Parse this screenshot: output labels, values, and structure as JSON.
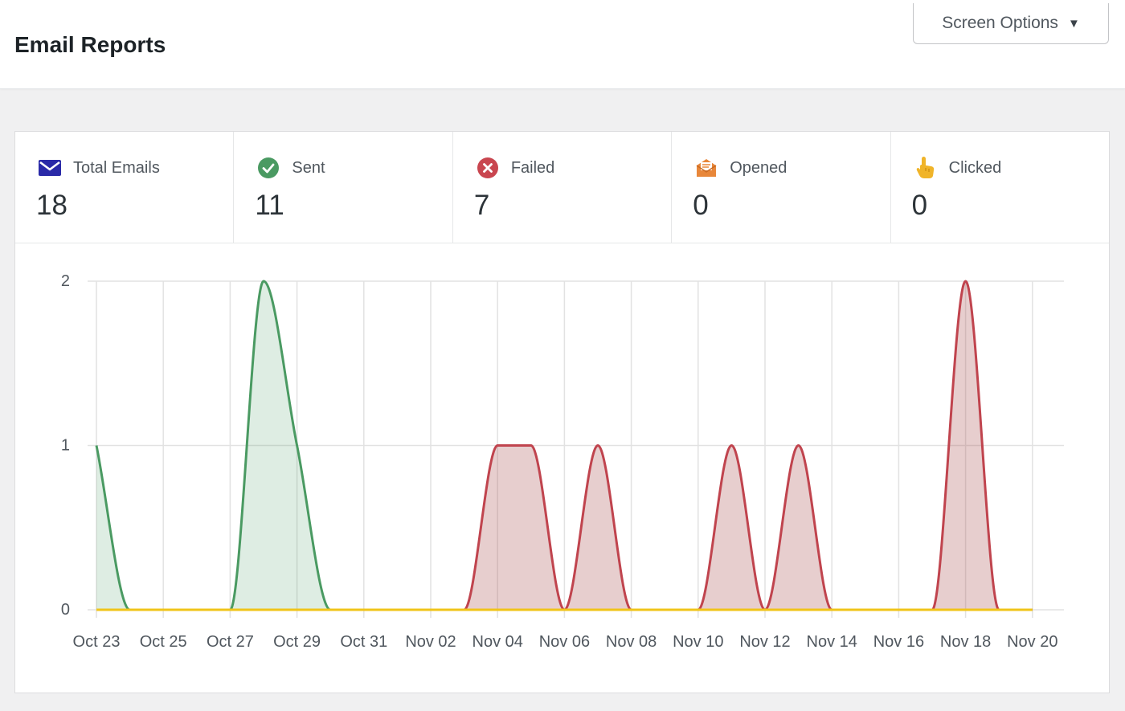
{
  "header": {
    "title": "Email Reports",
    "screen_options_label": "Screen Options"
  },
  "stats": [
    {
      "label": "Total Emails",
      "value": "18",
      "icon": "envelope-icon",
      "color": "#2a2aa8"
    },
    {
      "label": "Sent",
      "value": "11",
      "icon": "check-circle-icon",
      "color": "#4a9a62"
    },
    {
      "label": "Failed",
      "value": "7",
      "icon": "x-circle-icon",
      "color": "#c9464f"
    },
    {
      "label": "Opened",
      "value": "0",
      "icon": "open-envelope-icon",
      "color": "#e8873a"
    },
    {
      "label": "Clicked",
      "value": "0",
      "icon": "pointing-hand-icon",
      "color": "#f0b429"
    }
  ],
  "chart_data": {
    "type": "area",
    "x": [
      "Oct 23",
      "Oct 24",
      "Oct 25",
      "Oct 26",
      "Oct 27",
      "Oct 28",
      "Oct 29",
      "Oct 30",
      "Oct 31",
      "Nov 01",
      "Nov 02",
      "Nov 03",
      "Nov 04",
      "Nov 05",
      "Nov 06",
      "Nov 07",
      "Nov 08",
      "Nov 09",
      "Nov 10",
      "Nov 11",
      "Nov 12",
      "Nov 13",
      "Nov 14",
      "Nov 15",
      "Nov 16",
      "Nov 17",
      "Nov 18",
      "Nov 19",
      "Nov 20"
    ],
    "tick_labels": [
      "Oct 23",
      "Oct 25",
      "Oct 27",
      "Oct 29",
      "Oct 31",
      "Nov 02",
      "Nov 04",
      "Nov 06",
      "Nov 08",
      "Nov 10",
      "Nov 12",
      "Nov 14",
      "Nov 16",
      "Nov 18",
      "Nov 20"
    ],
    "y_ticks": [
      "0",
      "1",
      "2"
    ],
    "ylim": [
      0,
      2
    ],
    "grid": true,
    "series": [
      {
        "name": "Sent",
        "color": "#4a9a62",
        "fill": "rgba(74,154,98,0.18)",
        "values": [
          1,
          0,
          0,
          0,
          0,
          2,
          1,
          0,
          0,
          0,
          0,
          0,
          0,
          0,
          0,
          0,
          0,
          0,
          0,
          0,
          0,
          0,
          0,
          0,
          0,
          0,
          0,
          0,
          0
        ]
      },
      {
        "name": "Failed",
        "color": "#c0444e",
        "fill": "rgba(170,80,80,0.28)",
        "values": [
          0,
          0,
          0,
          0,
          0,
          0,
          0,
          0,
          0,
          0,
          0,
          0,
          1,
          1,
          0,
          1,
          0,
          0,
          0,
          1,
          0,
          1,
          0,
          0,
          0,
          0,
          2,
          0,
          0
        ]
      },
      {
        "name": "Opened",
        "color": "#f0c419",
        "fill": "none",
        "values": [
          0,
          0,
          0,
          0,
          0,
          0,
          0,
          0,
          0,
          0,
          0,
          0,
          0,
          0,
          0,
          0,
          0,
          0,
          0,
          0,
          0,
          0,
          0,
          0,
          0,
          0,
          0,
          0,
          0
        ]
      }
    ]
  }
}
